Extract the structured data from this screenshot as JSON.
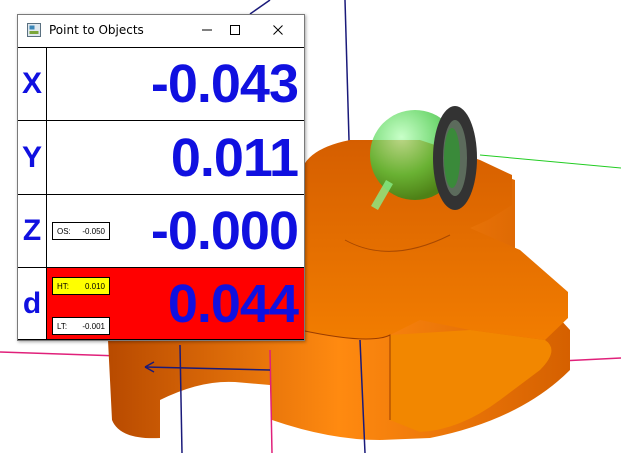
{
  "window": {
    "title": "Point to Objects",
    "minimize_icon": "minimize-icon",
    "maximize_icon": "maximize-icon",
    "close_icon": "close-icon"
  },
  "rows": [
    {
      "axis": "X",
      "value": "-0.043"
    },
    {
      "axis": "Y",
      "value": "0.011"
    },
    {
      "axis": "Z",
      "value": "-0.000",
      "os_label": "OS:",
      "os_value": "-0.050"
    },
    {
      "axis": "d",
      "value": "0.044",
      "ht_label": "HT:",
      "ht_value": "0.010",
      "lt_label": "LT:",
      "lt_value": "-0.001"
    }
  ],
  "colors": {
    "value_text": "#1010e0",
    "deviation_bg": "#ff0000",
    "ht_chip_bg": "#ffff00",
    "part_orange": "#f07800",
    "probe_green": "#33cc33",
    "axis_magenta": "#e0207a",
    "axis_navy": "#1a1a7a"
  }
}
